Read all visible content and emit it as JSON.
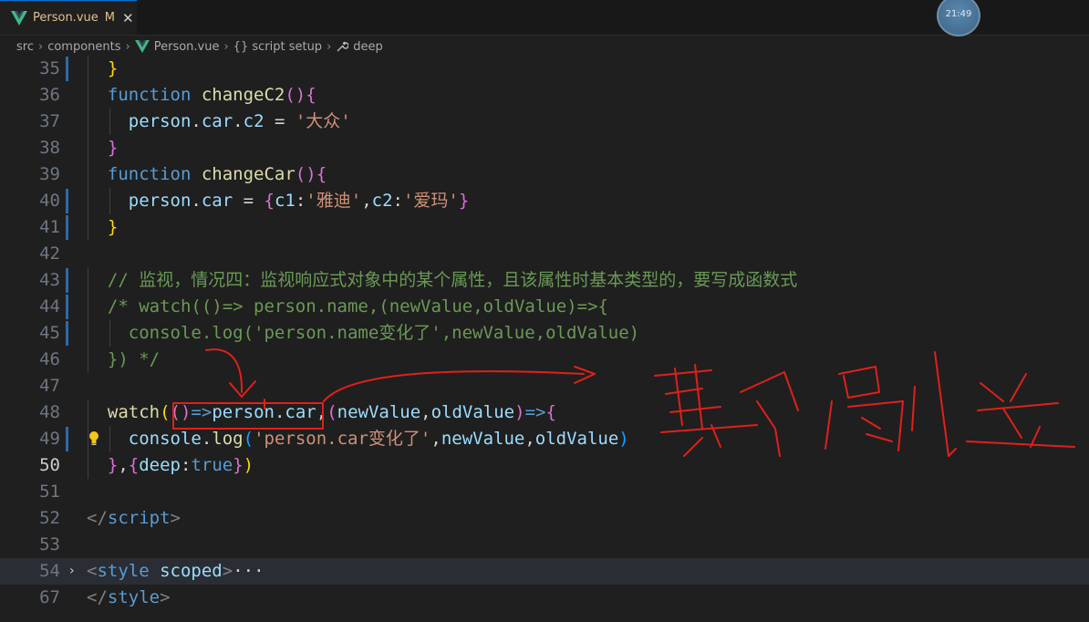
{
  "tab": {
    "label": "Person.vue",
    "modified": "M",
    "close": "✕"
  },
  "clock": "21:49",
  "breadcrumb": [
    "src",
    "components",
    "Person.vue",
    "{} script setup",
    "deep"
  ],
  "lines": [
    {
      "n": "35",
      "segs": [
        [
          "br1",
          "  }"
        ]
      ]
    },
    {
      "n": "36",
      "segs": [
        [
          "kw",
          "  function "
        ],
        [
          "fn",
          "changeC2"
        ],
        [
          "br2",
          "()"
        ],
        [
          "br2",
          "{"
        ]
      ]
    },
    {
      "n": "37",
      "segs": [
        [
          "var",
          "    person"
        ],
        [
          "op",
          "."
        ],
        [
          "var",
          "car"
        ],
        [
          "op",
          "."
        ],
        [
          "var",
          "c2"
        ],
        [
          "op",
          " = "
        ],
        [
          "str",
          "'大众'"
        ]
      ]
    },
    {
      "n": "38",
      "segs": [
        [
          "br2",
          "  }"
        ]
      ]
    },
    {
      "n": "39",
      "segs": [
        [
          "kw",
          "  function "
        ],
        [
          "fn",
          "changeCar"
        ],
        [
          "br2",
          "()"
        ],
        [
          "br2",
          "{"
        ]
      ]
    },
    {
      "n": "40",
      "segs": [
        [
          "var",
          "    person"
        ],
        [
          "op",
          "."
        ],
        [
          "var",
          "car"
        ],
        [
          "op",
          " = "
        ],
        [
          "br2",
          "{"
        ],
        [
          "var",
          "c1"
        ],
        [
          "op",
          ":"
        ],
        [
          "str",
          "'雅迪'"
        ],
        [
          "op",
          ","
        ],
        [
          "var",
          "c2"
        ],
        [
          "op",
          ":"
        ],
        [
          "str",
          "'爱玛'"
        ],
        [
          "br2",
          "}"
        ]
      ]
    },
    {
      "n": "41",
      "segs": [
        [
          "br1",
          "  }"
        ]
      ]
    },
    {
      "n": "42",
      "segs": []
    },
    {
      "n": "43",
      "segs": [
        [
          "cm",
          "  // 监视，情况四：监视响应式对象中的某个属性，且该属性时基本类型的，要写成函数式"
        ]
      ]
    },
    {
      "n": "44",
      "segs": [
        [
          "cm",
          "  /* watch(()=> person.name,(newValue,oldValue)=>{"
        ]
      ]
    },
    {
      "n": "45",
      "segs": [
        [
          "cm",
          "    console.log('person.name变化了',newValue,oldValue)"
        ]
      ]
    },
    {
      "n": "46",
      "segs": [
        [
          "cm",
          "  }) */"
        ]
      ]
    },
    {
      "n": "47",
      "segs": []
    },
    {
      "n": "48",
      "segs": [
        [
          "fn",
          "  watch"
        ],
        [
          "br1",
          "("
        ],
        [
          "br2",
          "()"
        ],
        [
          "kw",
          "=>"
        ],
        [
          "var",
          "person"
        ],
        [
          "op",
          "."
        ],
        [
          "var",
          "car"
        ],
        [
          "op",
          ","
        ],
        [
          "br2",
          "("
        ],
        [
          "var",
          "newValue"
        ],
        [
          "op",
          ","
        ],
        [
          "var",
          "oldValue"
        ],
        [
          "br2",
          ")"
        ],
        [
          "kw",
          "=>"
        ],
        [
          "br2",
          "{"
        ]
      ]
    },
    {
      "n": "49",
      "segs": [
        [
          "var",
          "    console"
        ],
        [
          "op",
          "."
        ],
        [
          "fn",
          "log"
        ],
        [
          "br3",
          "("
        ],
        [
          "str",
          "'person.car变化了'"
        ],
        [
          "op",
          ","
        ],
        [
          "var",
          "newValue"
        ],
        [
          "op",
          ","
        ],
        [
          "var",
          "oldValue"
        ],
        [
          "br3",
          ")"
        ]
      ]
    },
    {
      "n": "50",
      "segs": [
        [
          "br2",
          "  }"
        ],
        [
          "op",
          ","
        ],
        [
          "br2",
          "{"
        ],
        [
          "var",
          "deep"
        ],
        [
          "op",
          ":"
        ],
        [
          "bool",
          "true"
        ],
        [
          "br2",
          "}"
        ],
        [
          "br1",
          ")"
        ]
      ]
    },
    {
      "n": "51",
      "segs": []
    },
    {
      "n": "52",
      "segs": [
        [
          "tagc",
          "</"
        ],
        [
          "tagn",
          "script"
        ],
        [
          "tagc",
          ">"
        ]
      ]
    },
    {
      "n": "53",
      "segs": []
    },
    {
      "n": "54",
      "segs": [
        [
          "tagc",
          "<"
        ],
        [
          "tagn",
          "style"
        ],
        [
          "attr",
          " scoped"
        ],
        [
          "tagc",
          ">"
        ],
        [
          "op",
          "···"
        ]
      ]
    },
    {
      "n": "67",
      "segs": [
        [
          "tagc",
          "</"
        ],
        [
          "tagn",
          "style"
        ],
        [
          "tagc",
          ">"
        ]
      ]
    }
  ],
  "colors": {
    "accent": "#0078d4",
    "annotation": "#e0201a",
    "vue_green": "#41b883"
  }
}
